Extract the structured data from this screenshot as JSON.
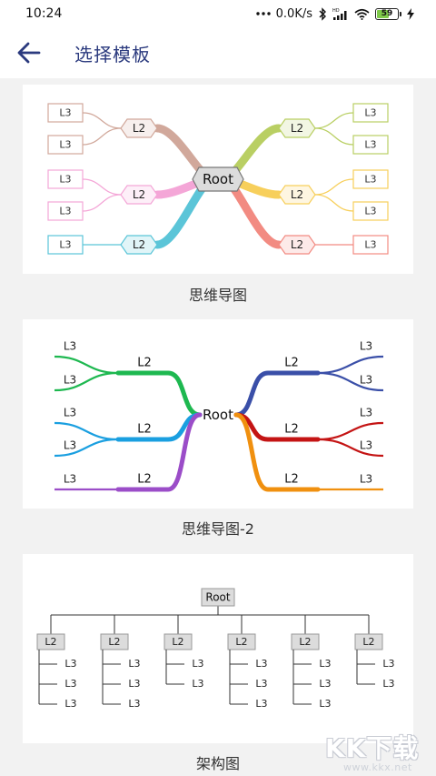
{
  "status_bar": {
    "time": "10:24",
    "network_speed": "0.0K/s",
    "battery_level": "59",
    "battery_percent": 59,
    "icons": [
      "more-dots-icon",
      "bluetooth-icon",
      "hd-signal-icon",
      "wifi-icon",
      "battery-icon",
      "charging-icon"
    ]
  },
  "app_bar": {
    "back_icon": "arrow-left-icon",
    "title": "选择模板"
  },
  "colors": {
    "accent": "#2b3a7e",
    "mind_l2": [
      "#d1a89b",
      "#f4a6d7",
      "#5bc5d8",
      "#b9cf63",
      "#f7cf5b",
      "#f28b82"
    ],
    "mind2_l2": [
      "#1eb850",
      "#1a9fe0",
      "#9b4dc8",
      "#3a4fa8",
      "#c41414",
      "#f0900f"
    ]
  },
  "templates": [
    {
      "label": "思维导图",
      "root": "Root",
      "branches": [
        {
          "label": "L2",
          "children": [
            "L3",
            "L3"
          ]
        },
        {
          "label": "L2",
          "children": [
            "L3",
            "L3"
          ]
        },
        {
          "label": "L2",
          "children": [
            "L3"
          ]
        },
        {
          "label": "L2",
          "children": [
            "L3",
            "L3"
          ]
        },
        {
          "label": "L2",
          "children": [
            "L3",
            "L3"
          ]
        },
        {
          "label": "L2",
          "children": [
            "L3"
          ]
        }
      ]
    },
    {
      "label": "思维导图-2",
      "root": "Root",
      "branches": [
        {
          "label": "L2",
          "children": [
            "L3",
            "L3"
          ]
        },
        {
          "label": "L2",
          "children": [
            "L3",
            "L3"
          ]
        },
        {
          "label": "L2",
          "children": [
            "L3"
          ]
        },
        {
          "label": "L2",
          "children": [
            "L3",
            "L3"
          ]
        },
        {
          "label": "L2",
          "children": [
            "L3",
            "L3"
          ]
        },
        {
          "label": "L2",
          "children": [
            "L3"
          ]
        }
      ]
    },
    {
      "label": "架构图",
      "root": "Root",
      "branches": [
        {
          "label": "L2",
          "children": [
            "L3",
            "L3",
            "L3"
          ]
        },
        {
          "label": "L2",
          "children": [
            "L3",
            "L3",
            "L3"
          ]
        },
        {
          "label": "L2",
          "children": [
            "L3",
            "L3"
          ]
        },
        {
          "label": "L2",
          "children": [
            "L3",
            "L3",
            "L3"
          ]
        },
        {
          "label": "L2",
          "children": [
            "L3",
            "L3",
            "L3"
          ]
        },
        {
          "label": "L2",
          "children": [
            "L3",
            "L3"
          ]
        }
      ]
    }
  ],
  "watermark": {
    "text": "KK下载",
    "url": "www.kkx.net"
  }
}
